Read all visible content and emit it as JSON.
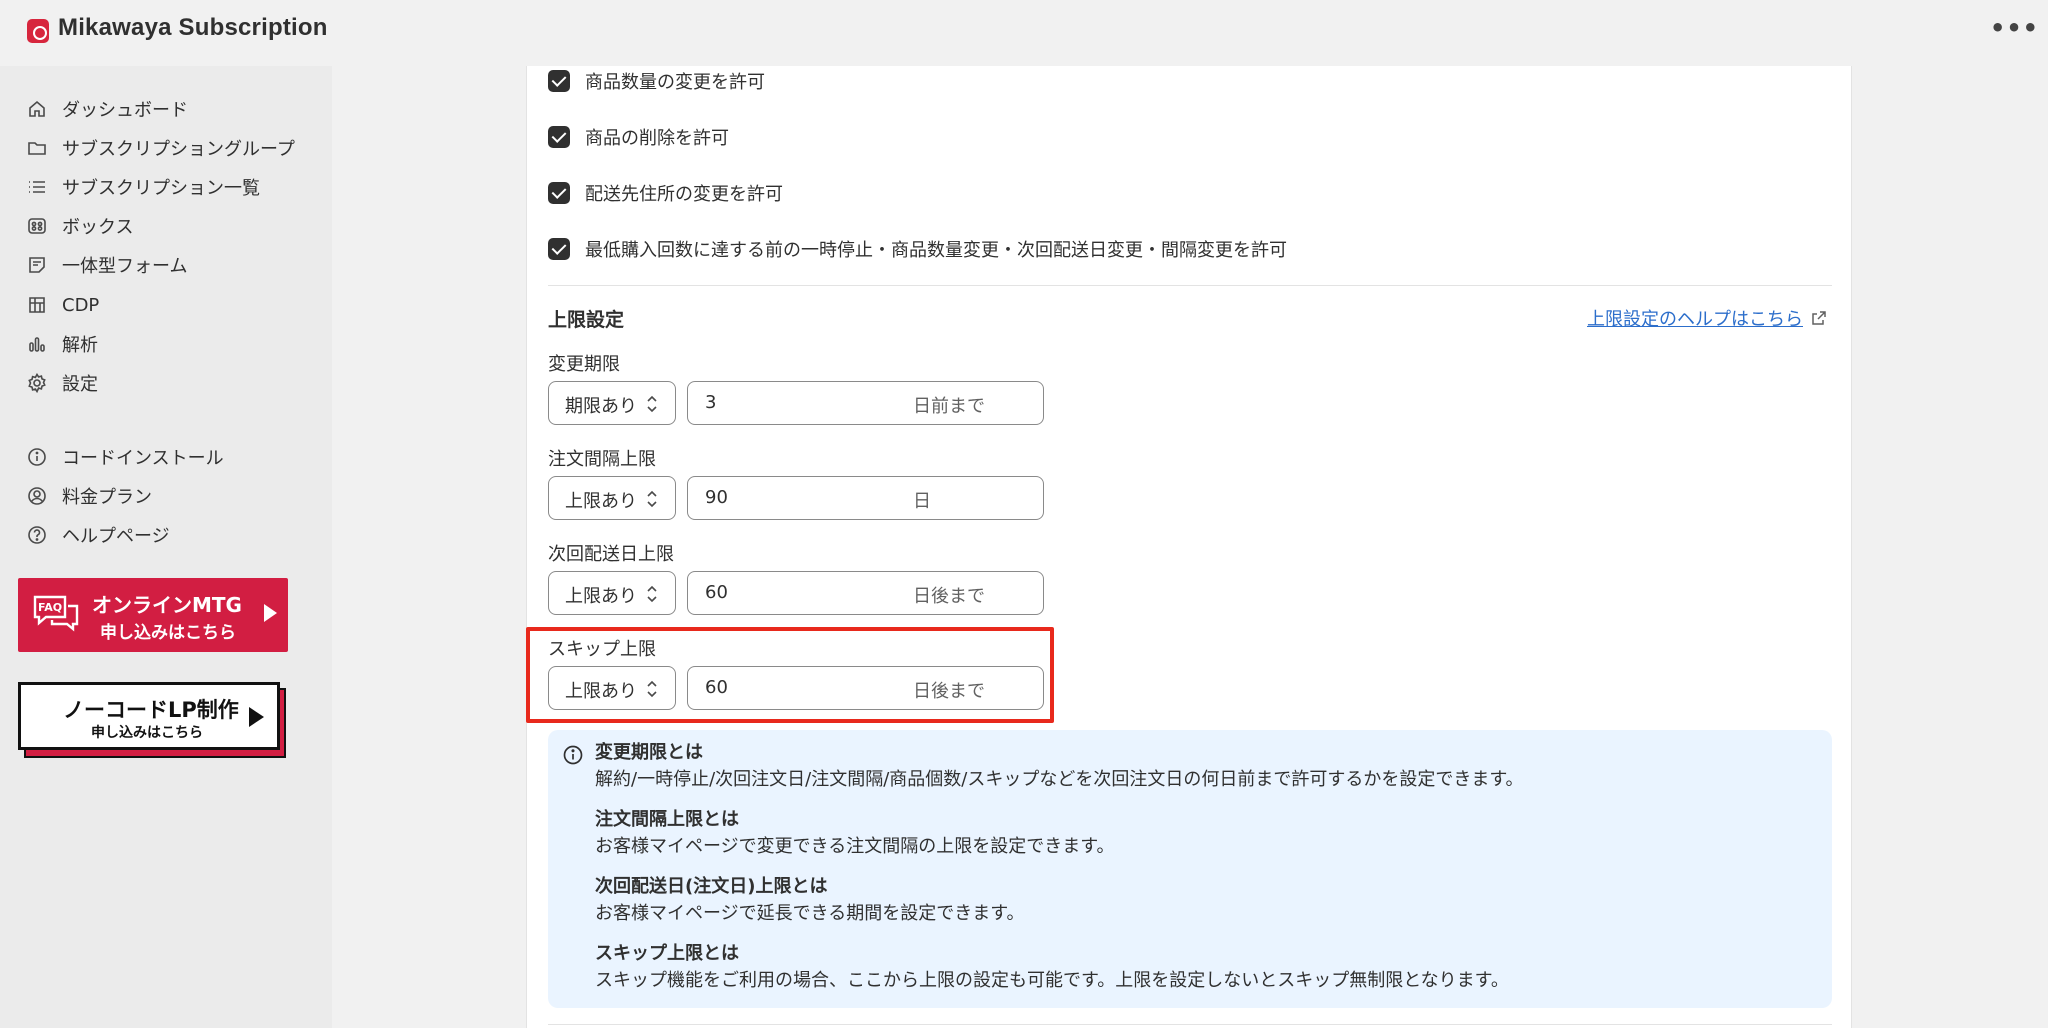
{
  "app": {
    "title": "Mikawaya Subscription",
    "more_label": "•••"
  },
  "sidebar": {
    "items": [
      {
        "label": "ダッシュボード",
        "icon": "home-icon"
      },
      {
        "label": "サブスクリプショングループ",
        "icon": "folder-icon"
      },
      {
        "label": "サブスクリプション一覧",
        "icon": "list-icon"
      },
      {
        "label": "ボックス",
        "icon": "box-icon"
      },
      {
        "label": "一体型フォーム",
        "icon": "form-icon"
      },
      {
        "label": "CDP",
        "icon": "grid-icon"
      },
      {
        "label": "解析",
        "icon": "chart-icon"
      },
      {
        "label": "設定",
        "icon": "gear-icon"
      },
      {
        "label": "コードインストール",
        "icon": "info-icon"
      },
      {
        "label": "料金プラン",
        "icon": "user-circle-icon"
      },
      {
        "label": "ヘルプページ",
        "icon": "help-icon"
      }
    ],
    "banner_mtg": {
      "badge": "FAQ",
      "line1": "オンラインMTG",
      "line2": "申し込みはこちら"
    },
    "banner_lp": {
      "line1": "ノーコードLP制作",
      "line2": "申し込みはこちら"
    }
  },
  "permissions": [
    {
      "label": "商品数量の変更を許可",
      "checked": true
    },
    {
      "label": "商品の削除を許可",
      "checked": true
    },
    {
      "label": "配送先住所の変更を許可",
      "checked": true
    },
    {
      "label": "最低購入回数に達する前の一時停止・商品数量変更・次回配送日変更・間隔変更を許可",
      "checked": true
    }
  ],
  "limits": {
    "title": "上限設定",
    "help_link": "上限設定のヘルプはこちら",
    "fields": [
      {
        "label": "変更期限",
        "select": "期限あり",
        "value": "3",
        "suffix": "日前まで"
      },
      {
        "label": "注文間隔上限",
        "select": "上限あり",
        "value": "90",
        "suffix": "日"
      },
      {
        "label": "次回配送日上限",
        "select": "上限あり",
        "value": "60",
        "suffix": "日後まで"
      },
      {
        "label": "スキップ上限",
        "select": "上限あり",
        "value": "60",
        "suffix": "日後まで"
      }
    ]
  },
  "info": [
    {
      "heading": "変更期限とは",
      "text": "解約/一時停止/次回注文日/注文間隔/商品個数/スキップなどを次回注文日の何日前まで許可するかを設定できます。"
    },
    {
      "heading": "注文間隔上限とは",
      "text": "お客様マイページで変更できる注文間隔の上限を設定できます。"
    },
    {
      "heading": "次回配送日(注文日)上限とは",
      "text": "お客様マイページで延長できる期間を設定できます。"
    },
    {
      "heading": "スキップ上限とは",
      "text": "スキップ機能をご利用の場合、ここから上限の設定も可能です。上限を設定しないとスキップ無制限となります。"
    }
  ],
  "colors": {
    "accent": "#d21e42",
    "highlight": "#e8291c",
    "link": "#2c6ecb",
    "info_bg": "#eaf4ff"
  }
}
